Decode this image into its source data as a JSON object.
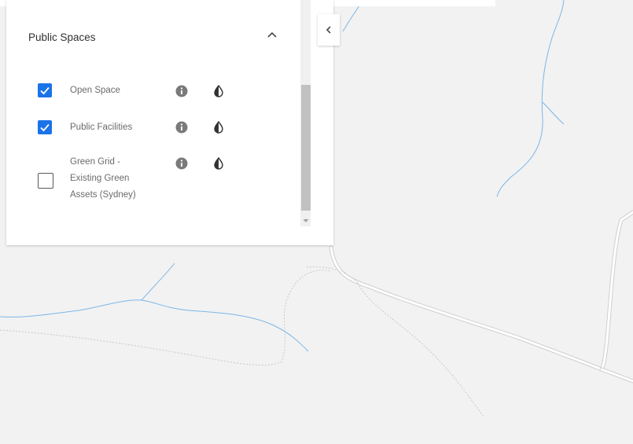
{
  "panel": {
    "section_title": "Public Spaces",
    "layers": [
      {
        "label": "Open Space",
        "checked": true
      },
      {
        "label": "Public Facilities",
        "checked": true
      },
      {
        "label": "Green Grid -\nExisting Green\nAssets (Sydney)",
        "checked": false
      }
    ]
  },
  "icons": {
    "collapse_section": "chevron-up-icon",
    "collapse_panel": "chevron-left-icon",
    "info": "info-icon",
    "opacity": "opacity-icon",
    "check": "checkmark-icon"
  },
  "colors": {
    "checkbox_checked": "#1a73e8",
    "map_background": "#f2f2f2",
    "waterway": "#7bb6e8",
    "road": "#ffffff",
    "road_outline": "#d0d0d0"
  }
}
